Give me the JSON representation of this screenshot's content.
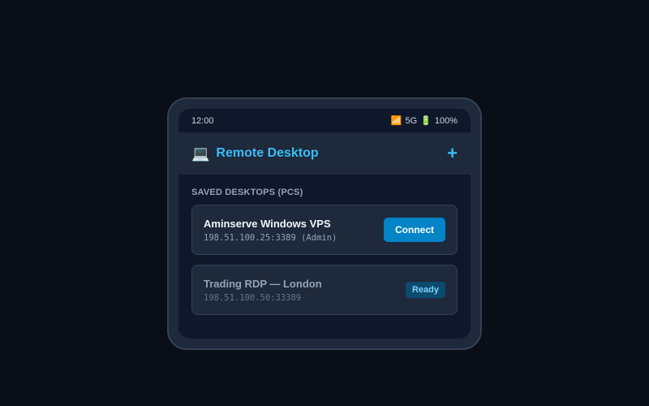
{
  "status_bar": {
    "time": "12:00",
    "signal_icon": "📶",
    "network": "5G",
    "battery_icon": "🔋",
    "battery": "100%"
  },
  "app_bar": {
    "icon": "💻",
    "title": "Remote Desktop",
    "add_label": "+"
  },
  "section": {
    "label": "SAVED DESKTOPS (PCS)"
  },
  "desktops": [
    {
      "name": "Aminserve Windows VPS",
      "address": "198.51.100.25:3389 (Admin)",
      "action_label": "Connect"
    },
    {
      "name": "Trading RDP — London",
      "address": "198.51.100.50:33389",
      "status_label": "Ready"
    }
  ],
  "colors": {
    "accent": "#38bdf8",
    "connect_button": "#0284c7",
    "background": "#0a0e17"
  }
}
